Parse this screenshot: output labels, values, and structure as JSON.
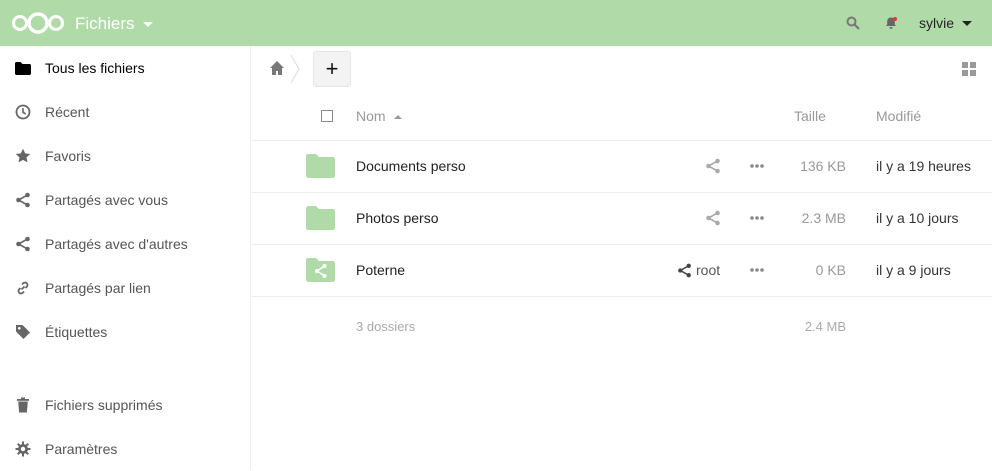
{
  "header": {
    "app_title": "Fichiers",
    "user": "sylvie",
    "colors": {
      "header_bg": "#b0dba8",
      "folder": "#b0dba8"
    }
  },
  "sidebar": {
    "items": [
      {
        "label": "Tous les fichiers",
        "icon": "folder-icon"
      },
      {
        "label": "Récent",
        "icon": "clock-icon"
      },
      {
        "label": "Favoris",
        "icon": "star-icon"
      },
      {
        "label": "Partagés avec vous",
        "icon": "share-icon"
      },
      {
        "label": "Partagés avec d'autres",
        "icon": "share-icon"
      },
      {
        "label": "Partagés par lien",
        "icon": "link-icon"
      },
      {
        "label": "Étiquettes",
        "icon": "tag-icon"
      },
      {
        "label": "Fichiers supprimés",
        "icon": "trash-icon"
      },
      {
        "label": "Paramètres",
        "icon": "gear-icon"
      }
    ]
  },
  "toolbar": {
    "add_label": "+"
  },
  "table": {
    "columns": {
      "name": "Nom",
      "size": "Taille",
      "modified": "Modifié"
    },
    "rows": [
      {
        "name": "Documents perso",
        "size": "136 KB",
        "modified": "il y a 19 heures",
        "shared_with": ""
      },
      {
        "name": "Photos perso",
        "size": "2.3 MB",
        "modified": "il y a 10 jours",
        "shared_with": ""
      },
      {
        "name": "Poterne",
        "size": "0 KB",
        "modified": "il y a 9 jours",
        "shared_with": "root"
      }
    ],
    "summary": {
      "count": "3 dossiers",
      "total": "2.4 MB"
    }
  }
}
